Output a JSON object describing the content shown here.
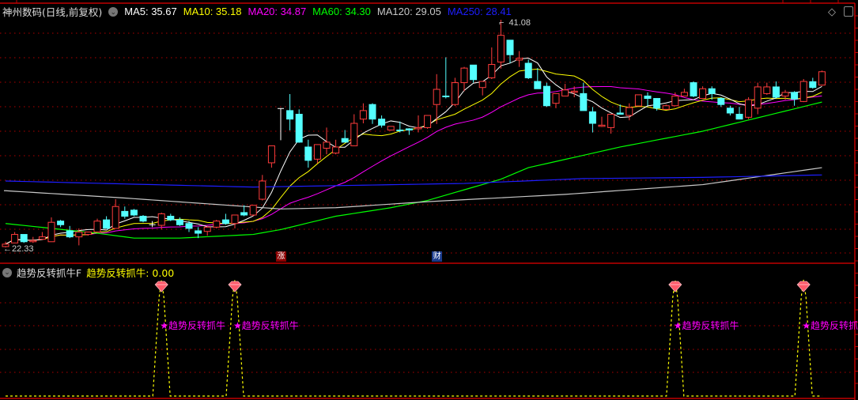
{
  "header": {
    "title": "神州数码(日线,前复权)",
    "ma": [
      {
        "label": "MA5: 35.67",
        "color": "#ffffff"
      },
      {
        "label": "MA10: 35.18",
        "color": "#ffff00"
      },
      {
        "label": "MA20: 34.87",
        "color": "#ff00ff"
      },
      {
        "label": "MA60: 34.30",
        "color": "#00ff00"
      },
      {
        "label": "MA120: 29.05",
        "color": "#c8c8c8"
      },
      {
        "label": "MA250: 28.41",
        "color": "#1e1eff"
      }
    ]
  },
  "indicator": {
    "name": "趋势反转抓牛F",
    "value_label": "趋势反转抓牛: 0.00",
    "signal_text": "★趋势反转抓牛"
  },
  "markers": {
    "low_label": "22.33",
    "high_label": "41.08",
    "zhang": "涨",
    "cai": "财"
  },
  "icons": [
    "chevron-down-icon",
    "diamond-icon",
    "panel-toggle-icon",
    "gem-icon"
  ],
  "colors": {
    "up": "#ff3c3c",
    "down": "#54ffff",
    "doji": "#ffffff",
    "grid": "#b00000",
    "signal": "#ffff00"
  },
  "chart_data": {
    "type": "candlestick",
    "title": "神州数码(日线,前复权)",
    "ylim": [
      22.33,
      41.08
    ],
    "candles_ohlc": [
      [
        22.4,
        22.6,
        22.8,
        22.33
      ],
      [
        22.7,
        23.4,
        23.6,
        22.7
      ],
      [
        23.4,
        22.8,
        23.4,
        22.7
      ],
      [
        22.8,
        22.9,
        23.2,
        22.7
      ],
      [
        23.0,
        23.2,
        23.6,
        23.0
      ],
      [
        22.8,
        24.4,
        24.8,
        22.8
      ],
      [
        24.5,
        24.2,
        24.6,
        24.0
      ],
      [
        23.7,
        23.2,
        24.1,
        23.1
      ],
      [
        23.2,
        23.6,
        23.9,
        22.5
      ],
      [
        23.4,
        23.6,
        23.6,
        23.3
      ],
      [
        23.6,
        24.5,
        24.7,
        23.6
      ],
      [
        24.6,
        23.9,
        24.9,
        23.9
      ],
      [
        23.9,
        25.7,
        26.3,
        23.9
      ],
      [
        25.3,
        24.9,
        25.7,
        24.7
      ],
      [
        25.4,
        25.0,
        25.5,
        24.9
      ],
      [
        24.9,
        24.5,
        25.0,
        24.4
      ],
      [
        24.2,
        24.2,
        24.5,
        24.0
      ],
      [
        24.15,
        25.1,
        25.2,
        23.8
      ],
      [
        24.9,
        24.6,
        25.1,
        24.5
      ],
      [
        24.6,
        24.2,
        24.8,
        24.1
      ],
      [
        24.3,
        23.9,
        24.5,
        23.6
      ],
      [
        23.7,
        23.5,
        24.0,
        23.1
      ],
      [
        23.65,
        24.0,
        24.1,
        23.3
      ],
      [
        24.0,
        24.5,
        24.6,
        23.9
      ],
      [
        24.6,
        24.3,
        25.1,
        24.2
      ],
      [
        24.3,
        25.0,
        25.0,
        23.9
      ],
      [
        25.2,
        25.0,
        25.8,
        24.9
      ],
      [
        25.0,
        25.8,
        25.8,
        24.9
      ],
      [
        26.3,
        27.8,
        28.3,
        26.2
      ],
      [
        29.3,
        30.7,
        30.7,
        28.9
      ],
      [
        33.77,
        33.77,
        33.77,
        31.16
      ],
      [
        33.6,
        32.9,
        34.96,
        31.97
      ],
      [
        33.3,
        31.0,
        33.7,
        30.95
      ],
      [
        30.6,
        29.5,
        31.2,
        28.9
      ],
      [
        29.6,
        30.8,
        30.8,
        29.25
      ],
      [
        30.5,
        31.0,
        32.2,
        30.0
      ],
      [
        30.1,
        30.6,
        31.2,
        30.0
      ],
      [
        31.3,
        31.0,
        32.0,
        30.95
      ],
      [
        30.7,
        32.55,
        33.3,
        30.7
      ],
      [
        32.9,
        33.6,
        34.2,
        32.55
      ],
      [
        34.1,
        32.9,
        34.2,
        32.5
      ],
      [
        32.9,
        32.4,
        33.2,
        32.2
      ],
      [
        32.0,
        32.3,
        32.3,
        31.95
      ],
      [
        32.0,
        31.98,
        32.7,
        31.8
      ],
      [
        32.1,
        32.0,
        32.15,
        31.6
      ],
      [
        32.1,
        32.2,
        33.2,
        31.8
      ],
      [
        32.2,
        33.2,
        33.2,
        32.1
      ],
      [
        34.1,
        35.35,
        36.6,
        32.5
      ],
      [
        34.8,
        34.78,
        37.99,
        34.6
      ],
      [
        34.1,
        35.9,
        36.3,
        33.98
      ],
      [
        35.9,
        37.1,
        37.2,
        35.2
      ],
      [
        37.35,
        36.15,
        37.35,
        35.9
      ],
      [
        35.5,
        36.0,
        36.0,
        34.85
      ],
      [
        36.3,
        37.4,
        38.8,
        36.2
      ],
      [
        37.6,
        39.8,
        41.08,
        37.06
      ],
      [
        39.4,
        38.2,
        39.4,
        37.5
      ],
      [
        37.76,
        37.9,
        38.5,
        37.2
      ],
      [
        37.5,
        36.3,
        37.8,
        36.2
      ],
      [
        36.0,
        35.4,
        37.1,
        35.4
      ],
      [
        35.6,
        34.0,
        35.9,
        33.9
      ],
      [
        34.2,
        35.0,
        35.0,
        33.8
      ],
      [
        34.8,
        35.3,
        35.8,
        34.8
      ],
      [
        35.1,
        35.2,
        35.6,
        34.7
      ],
      [
        35.0,
        33.6,
        35.9,
        33.6
      ],
      [
        33.5,
        32.55,
        33.9,
        31.8
      ],
      [
        32.3,
        32.4,
        33.1,
        32.25
      ],
      [
        32.2,
        33.3,
        33.3,
        31.7
      ],
      [
        33.4,
        33.3,
        34.1,
        33.3
      ],
      [
        33.2,
        33.85,
        34.2,
        32.8
      ],
      [
        33.98,
        34.9,
        34.9,
        33.98
      ],
      [
        34.8,
        34.6,
        35.1,
        34.0
      ],
      [
        34.6,
        33.8,
        34.6,
        33.6
      ],
      [
        33.7,
        34.0,
        34.1,
        33.7
      ],
      [
        34.0,
        34.8,
        35.1,
        34.0
      ],
      [
        34.8,
        35.1,
        35.4,
        34.8
      ],
      [
        35.9,
        34.8,
        36.0,
        34.7
      ],
      [
        34.6,
        35.4,
        35.6,
        34.6
      ],
      [
        35.4,
        35.0,
        35.6,
        34.5
      ],
      [
        34.6,
        34.1,
        34.7,
        33.9
      ],
      [
        33.8,
        33.4,
        34.0,
        33.2
      ],
      [
        33.3,
        32.9,
        33.9,
        32.9
      ],
      [
        33.05,
        34.5,
        34.7,
        32.9
      ],
      [
        33.8,
        35.55,
        35.9,
        33.3
      ],
      [
        35.0,
        35.55,
        35.9,
        34.9
      ],
      [
        35.55,
        34.7,
        36.0,
        34.6
      ],
      [
        34.8,
        35.1,
        35.3,
        34.5
      ],
      [
        35.1,
        34.55,
        35.2,
        34.0
      ],
      [
        34.35,
        36.0,
        36.2,
        34.3
      ],
      [
        35.98,
        35.5,
        36.3,
        35.4
      ],
      [
        35.7,
        36.8,
        36.9,
        35.65
      ]
    ],
    "ma_long_samples": {
      "MA60": [
        [
          0,
          24.3
        ],
        [
          10,
          23.5
        ],
        [
          14,
          23.1
        ],
        [
          19,
          23.1
        ],
        [
          27,
          23.4
        ],
        [
          30,
          23.8
        ],
        [
          36,
          24.9
        ],
        [
          42,
          25.6
        ],
        [
          46,
          26.2
        ],
        [
          54,
          27.95
        ],
        [
          57,
          28.9
        ],
        [
          67,
          30.6
        ],
        [
          76,
          31.9
        ],
        [
          89,
          34.3
        ]
      ],
      "MA120": [
        [
          0,
          27.0
        ],
        [
          13,
          26.4
        ],
        [
          30,
          25.5
        ],
        [
          36,
          25.6
        ],
        [
          46,
          26.1
        ],
        [
          61,
          26.7
        ],
        [
          76,
          27.5
        ],
        [
          89,
          28.9
        ]
      ],
      "MA250": [
        [
          0,
          27.8
        ],
        [
          27,
          27.3
        ],
        [
          50,
          27.6
        ],
        [
          63,
          28.0
        ],
        [
          76,
          28.1
        ],
        [
          89,
          28.3
        ]
      ]
    },
    "signal": {
      "name": "趋势反转抓牛",
      "ylim": [
        0,
        1
      ],
      "trigger_indices": [
        17,
        25,
        73,
        87
      ]
    },
    "annotations": {
      "low": 22.33,
      "high": 41.08,
      "low_index": 0,
      "high_index": 54,
      "zhang_index": 30,
      "cai_index": 47
    }
  }
}
